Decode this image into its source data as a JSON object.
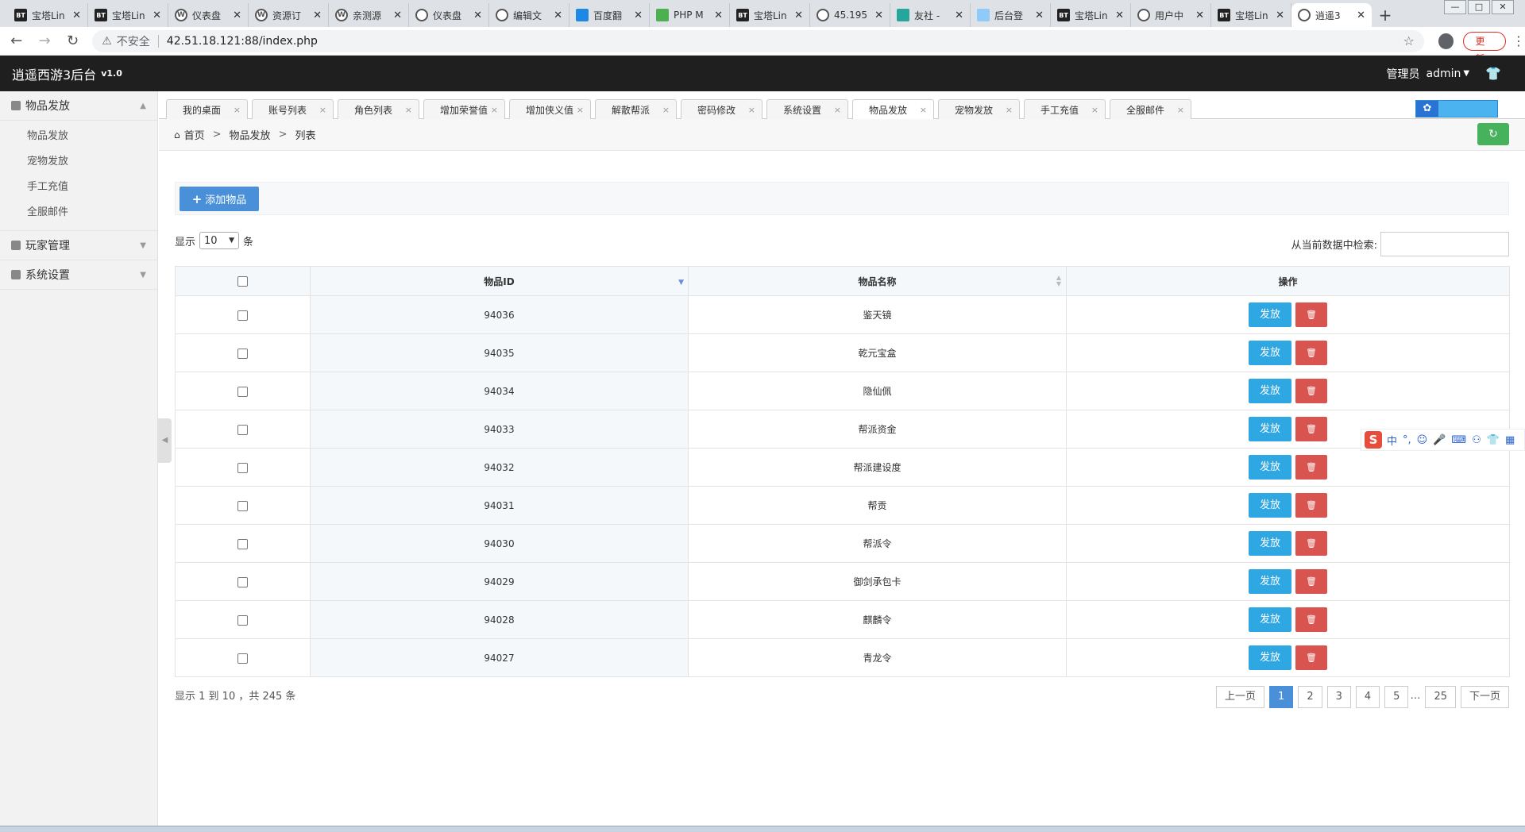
{
  "browser": {
    "tabs": [
      {
        "favicon": "bt",
        "title": "宝塔Lin"
      },
      {
        "favicon": "bt",
        "title": "宝塔Lin"
      },
      {
        "favicon": "wp",
        "title": "仪表盘"
      },
      {
        "favicon": "wp",
        "title": "资源订"
      },
      {
        "favicon": "wp",
        "title": "亲测源"
      },
      {
        "favicon": "globe",
        "title": "仪表盘"
      },
      {
        "favicon": "globe",
        "title": "编辑文"
      },
      {
        "favicon": "blue",
        "title": "百度翻"
      },
      {
        "favicon": "green",
        "title": "PHP M"
      },
      {
        "favicon": "bt",
        "title": "宝塔Lin"
      },
      {
        "favicon": "globe",
        "title": "45.195"
      },
      {
        "favicon": "teal",
        "title": "友社 -"
      },
      {
        "favicon": "light",
        "title": "后台登"
      },
      {
        "favicon": "bt",
        "title": "宝塔Lin"
      },
      {
        "favicon": "globe",
        "title": "用户中"
      },
      {
        "favicon": "bt",
        "title": "宝塔Lin"
      },
      {
        "favicon": "globe",
        "title": "逍遥3"
      }
    ],
    "insecure_label": "不安全",
    "url": "42.51.18.121:88/index.php",
    "update_label": "更新"
  },
  "header": {
    "title": "逍遥西游3后台",
    "version": "v1.0",
    "role": "管理员",
    "user": "admin"
  },
  "sidebar": {
    "groups": [
      {
        "label": "物品发放",
        "items": [
          "物品发放",
          "宠物发放",
          "手工充值",
          "全服邮件"
        ]
      },
      {
        "label": "玩家管理"
      },
      {
        "label": "系统设置"
      }
    ]
  },
  "content_tabs": [
    "我的桌面",
    "账号列表",
    "角色列表",
    "增加荣誉值",
    "增加侠义值",
    "解散帮派",
    "密码修改",
    "系统设置",
    "物品发放",
    "宠物发放",
    "手工充值",
    "全服邮件"
  ],
  "active_tab_index": 8,
  "breadcrumb": {
    "home": "首页",
    "section": "物品发放",
    "page": "列表"
  },
  "toolbar": {
    "add_label": "添加物品"
  },
  "length": {
    "prefix": "显示",
    "value": "10",
    "suffix": "条"
  },
  "search": {
    "label": "从当前数据中检索:"
  },
  "table": {
    "headers": {
      "id": "物品ID",
      "name": "物品名称",
      "ops": "操作"
    },
    "send_label": "发放",
    "rows": [
      {
        "id": "94036",
        "name": "鉴天镜"
      },
      {
        "id": "94035",
        "name": "乾元宝盒"
      },
      {
        "id": "94034",
        "name": "隐仙佩"
      },
      {
        "id": "94033",
        "name": "帮派资金"
      },
      {
        "id": "94032",
        "name": "帮派建设度"
      },
      {
        "id": "94031",
        "name": "帮贡"
      },
      {
        "id": "94030",
        "name": "帮派令"
      },
      {
        "id": "94029",
        "name": "御剑承包卡"
      },
      {
        "id": "94028",
        "name": "麒麟令"
      },
      {
        "id": "94027",
        "name": "青龙令"
      }
    ]
  },
  "info": "显示 1 到 10 ，共 245 条",
  "pagination": {
    "prev": "上一页",
    "pages": [
      "1",
      "2",
      "3",
      "4",
      "5"
    ],
    "ellipsis": "…",
    "last": "25",
    "next": "下一页",
    "current": "1"
  },
  "ime": {
    "mode": "中",
    "punct": "°,"
  },
  "colors": {
    "accent": "#4a90d9",
    "send": "#2fa7e3",
    "delete": "#d9534f",
    "refresh": "#46b35c",
    "header_bg": "#1f1f1f"
  }
}
